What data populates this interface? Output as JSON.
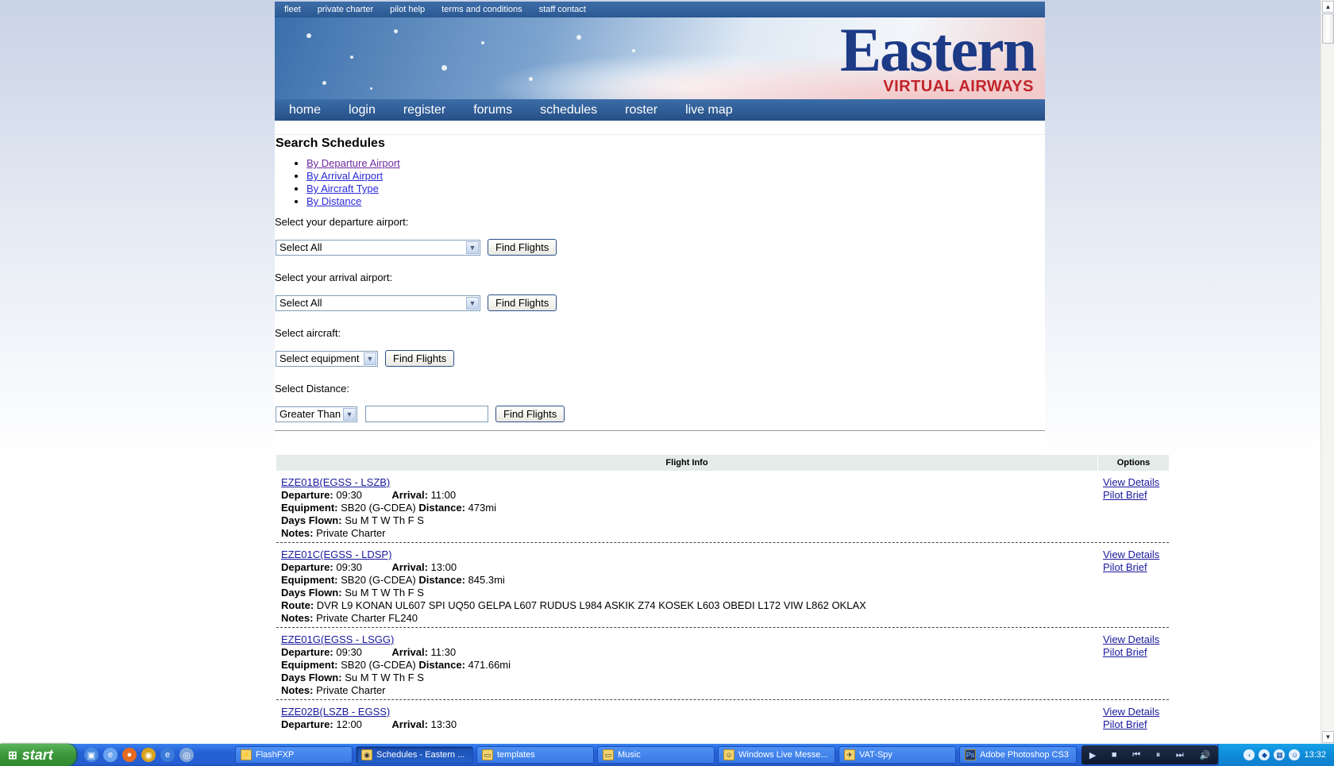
{
  "topnav": [
    "fleet",
    "private charter",
    "pilot help",
    "terms and conditions",
    "staff contact"
  ],
  "logo": {
    "main": "Eastern",
    "sub": "VIRTUAL AIRWAYS"
  },
  "mainnav": [
    "home",
    "login",
    "register",
    "forums",
    "schedules",
    "roster",
    "live map"
  ],
  "search": {
    "title": "Search Schedules",
    "links": [
      "By Departure Airport",
      "By Arrival Airport",
      "By Aircraft Type",
      "By Distance"
    ],
    "departure_label": "Select your departure airport:",
    "departure_value": "Select All",
    "arrival_label": "Select your arrival airport:",
    "arrival_value": "Select All",
    "aircraft_label": "Select aircraft:",
    "aircraft_value": "Select equipment",
    "distance_label": "Select Distance:",
    "distance_value": "Greater Than",
    "distance_input": "",
    "button_label": "Find Flights"
  },
  "table": {
    "header_info": "Flight Info",
    "header_options": "Options",
    "labels": {
      "departure": "Departure:",
      "arrival": "Arrival:",
      "equipment": "Equipment:",
      "distance": "Distance:",
      "days": "Days Flown:",
      "route": "Route:",
      "notes": "Notes:"
    },
    "options": {
      "view": "View Details",
      "brief": "Pilot Brief"
    },
    "flights": [
      {
        "code": "EZE01B(EGSS - LSZB)",
        "departure": "09:30",
        "arrival": "11:00",
        "equipment": "SB20 (G-CDEA)",
        "distance": "473mi",
        "days": "Su M T W Th F S",
        "route": "",
        "notes": "Private Charter"
      },
      {
        "code": "EZE01C(EGSS - LDSP)",
        "departure": "09:30",
        "arrival": "13:00",
        "equipment": "SB20 (G-CDEA)",
        "distance": "845.3mi",
        "days": "Su M T W Th F S",
        "route": "DVR L9 KONAN UL607 SPI UQ50 GELPA L607 RUDUS L984 ASKIK Z74 KOSEK L603 OBEDI L172 VIW L862 OKLAX",
        "notes": "Private Charter FL240"
      },
      {
        "code": "EZE01G(EGSS - LSGG)",
        "departure": "09:30",
        "arrival": "11:30",
        "equipment": "SB20 (G-CDEA)",
        "distance": "471.66mi",
        "days": "Su M T W Th F S",
        "route": "",
        "notes": "Private Charter"
      },
      {
        "code": "EZE02B(LSZB - EGSS)",
        "departure": "12:00",
        "arrival": "13:30",
        "equipment": "",
        "distance": "",
        "days": "",
        "route": "",
        "notes": ""
      }
    ]
  },
  "taskbar": {
    "start": "start",
    "tasks": [
      "FlashFXP",
      "Schedules - Eastern ...",
      "templates",
      "Music",
      "Windows Live Messe...",
      "VAT-Spy",
      "Adobe Photoshop CS3"
    ],
    "clock": "13:32"
  }
}
